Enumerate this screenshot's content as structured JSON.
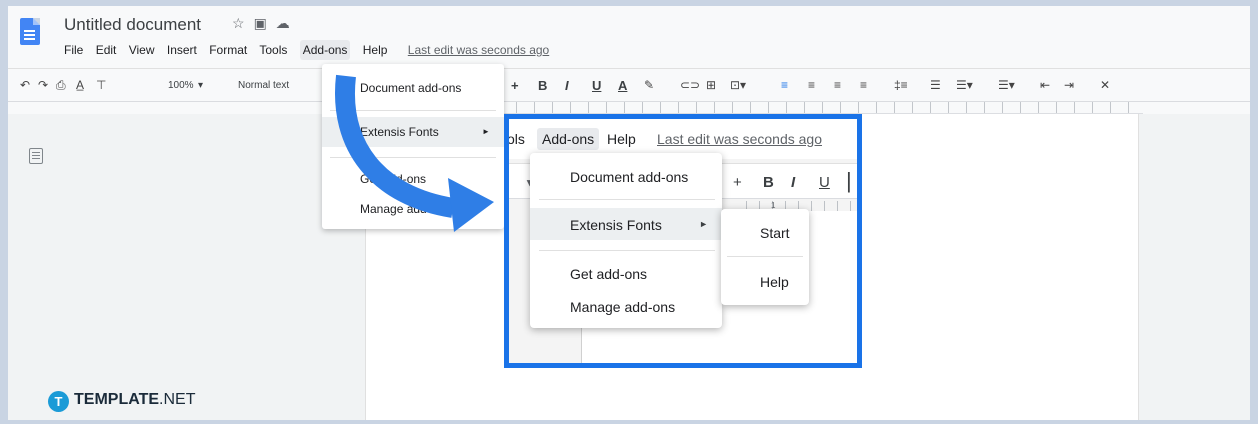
{
  "header": {
    "doc_title": "Untitled document",
    "menus": [
      "File",
      "Edit",
      "View",
      "Insert",
      "Format",
      "Tools",
      "Add-ons",
      "Help"
    ],
    "last_edit": "Last edit was seconds ago"
  },
  "toolbar": {
    "zoom": "100%",
    "style": "Normal text",
    "bold": "B",
    "italic": "I",
    "underline": "U",
    "text_color": "A",
    "plus": "+"
  },
  "bg_dropdown": {
    "items": [
      "Document add-ons",
      "Extensis Fonts",
      "Get add-ons",
      "Manage add-ons"
    ]
  },
  "zoom_view": {
    "menus": [
      "ols",
      "Add-ons",
      "Help"
    ],
    "last_edit": "Last edit was seconds ago",
    "toolbar": {
      "plus": "+",
      "bold": "B",
      "italic": "I",
      "underline": "U"
    },
    "ruler_mark": "1",
    "dropdown": {
      "items": [
        "Document add-ons",
        "Extensis Fonts",
        "Get add-ons",
        "Manage add-ons"
      ],
      "arrow": "►"
    },
    "submenu": {
      "items": [
        "Start",
        "Help"
      ]
    }
  },
  "brand": {
    "bold": "TEMPLATE",
    "rest": ".NET",
    "icon": "T"
  },
  "colors": {
    "accent": "#1a73e8",
    "arrow": "#2f7ee6"
  }
}
